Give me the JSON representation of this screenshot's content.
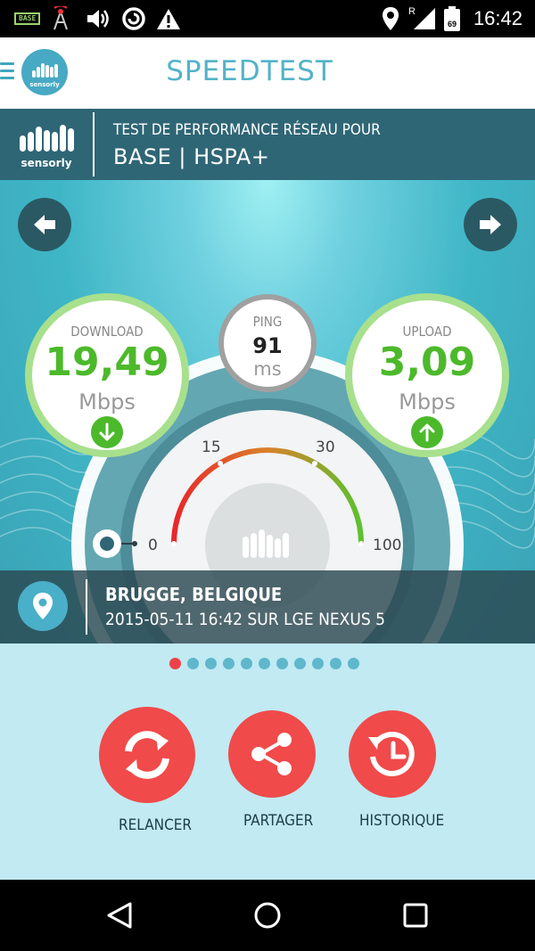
{
  "status_bar": {
    "carrier_badge": "BASE",
    "roaming_label": "R",
    "battery_level": "69",
    "time": "16:42",
    "icons": [
      "base-badge-icon",
      "signal-tower-icon",
      "volume-icon",
      "sync-icon",
      "warning-icon",
      "location-icon",
      "cell-signal-icon",
      "battery-icon"
    ]
  },
  "app_bar": {
    "title": "SPEEDTEST",
    "logo_text": "sensorly",
    "menu_icon": "hamburger-icon"
  },
  "banner": {
    "logo_text": "sensorly",
    "subtitle": "TEST DE PERFORMANCE RÉSEAU POUR",
    "network": "BASE | HSPA+"
  },
  "results": {
    "download": {
      "label": "DOWNLOAD",
      "value": "19,49",
      "unit": "Mbps"
    },
    "ping": {
      "label": "PING",
      "value": "91",
      "unit": "ms"
    },
    "upload": {
      "label": "UPLOAD",
      "value": "3,09",
      "unit": "Mbps"
    }
  },
  "gauge": {
    "ticks": [
      "0",
      "15",
      "30",
      "100"
    ],
    "colors": {
      "low": "#e8262b",
      "mid": "#d9822a",
      "high": "#5cc12e"
    }
  },
  "location": {
    "city": "BRUGGE, BELGIQUE",
    "detail": "2015-05-11 16:42 SUR LGE NEXUS 5"
  },
  "pagination": {
    "total": 11,
    "active": 1
  },
  "actions": [
    {
      "label": "RELANCER",
      "icon": "refresh-icon"
    },
    {
      "label": "PARTAGER",
      "icon": "share-icon"
    },
    {
      "label": "HISTORIQUE",
      "icon": "history-icon"
    }
  ],
  "colors": {
    "accent": "#53b3c8",
    "banner": "#2f6675",
    "success": "#4cb92b",
    "action": "#f04a4a",
    "panel": "#c2eaf2"
  }
}
